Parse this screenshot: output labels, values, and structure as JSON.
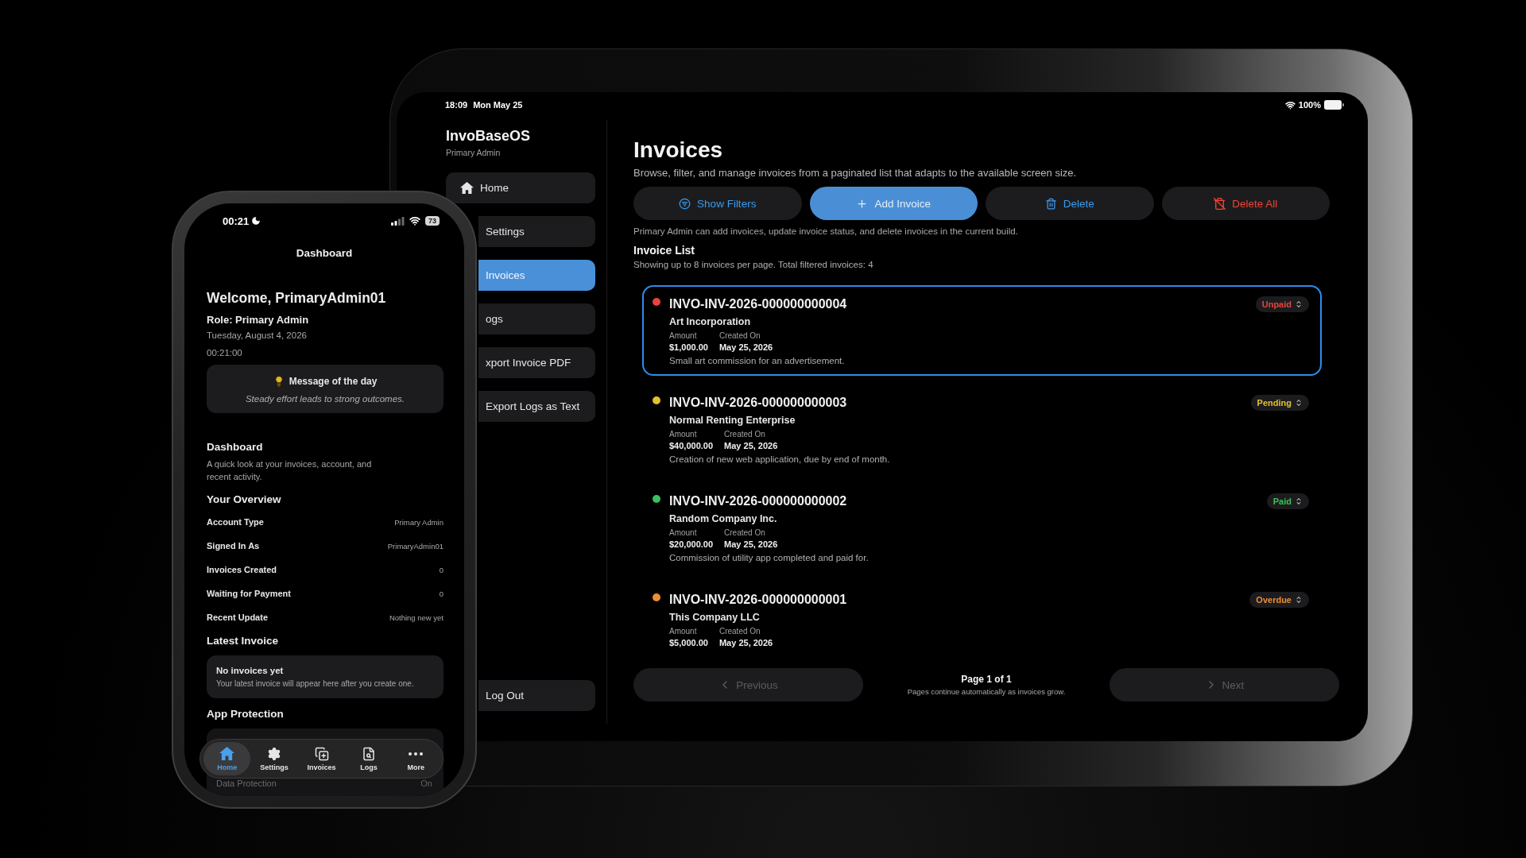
{
  "phone": {
    "status_bar": {
      "time": "00:21",
      "battery": "73"
    },
    "nav_title": "Dashboard",
    "welcome": "Welcome, PrimaryAdmin01",
    "role": "Role: Primary Admin",
    "date": "Tuesday, August 4, 2026",
    "clock": "00:21:00",
    "message_card": {
      "title": "Message of the day",
      "text": "Steady effort leads to strong outcomes."
    },
    "dashboard": {
      "heading": "Dashboard",
      "description": "A quick look at your invoices, account, and recent activity."
    },
    "overview": {
      "heading": "Your Overview",
      "rows": [
        {
          "label": "Account Type",
          "value": "Primary Admin"
        },
        {
          "label": "Signed In As",
          "value": "PrimaryAdmin01"
        },
        {
          "label": "Invoices Created",
          "value": "0"
        },
        {
          "label": "Waiting for Payment",
          "value": "0"
        },
        {
          "label": "Recent Update",
          "value": "Nothing new yet"
        }
      ]
    },
    "latest_invoice": {
      "heading": "Latest Invoice",
      "title": "No invoices yet",
      "text": "Your latest invoice will appear here after you create one."
    },
    "app_protection": {
      "heading": "App Protection",
      "rows": [
        {
          "label": "Data Protection",
          "value": "On"
        }
      ]
    },
    "tab_bar": [
      {
        "label": "Home",
        "selected": true
      },
      {
        "label": "Settings",
        "selected": false
      },
      {
        "label": "Invoices",
        "selected": false
      },
      {
        "label": "Logs",
        "selected": false
      },
      {
        "label": "More",
        "selected": false
      }
    ]
  },
  "tablet": {
    "status_bar": {
      "time": "18:09",
      "date": "Mon May 25",
      "battery": "100%"
    },
    "sidebar": {
      "title": "InvoBaseOS",
      "subtitle": "Primary Admin",
      "items": [
        {
          "label": "Home",
          "kind": "icon",
          "selected": false
        },
        {
          "label": "Settings",
          "kind": "text",
          "selected": false
        },
        {
          "label": "Invoices",
          "kind": "text",
          "selected": true
        },
        {
          "label": "ogs",
          "kind": "text",
          "selected": false
        },
        {
          "label": "xport Invoice PDF",
          "kind": "text",
          "selected": false
        },
        {
          "label": "Export Logs as Text",
          "kind": "text",
          "selected": false
        }
      ],
      "footer_item": "Log Out"
    },
    "page": {
      "title": "Invoices",
      "description": "Browse, filter, and manage invoices from a paginated list that adapts to the available screen size.",
      "buttons": [
        {
          "label": "Show Filters",
          "kind": "secondary"
        },
        {
          "label": "Add Invoice",
          "kind": "primary"
        },
        {
          "label": "Delete",
          "kind": "secondary"
        },
        {
          "label": "Delete All",
          "kind": "destructive"
        }
      ],
      "note": "Primary Admin can add invoices, update invoice status, and delete invoices in the current build.",
      "list": {
        "title": "Invoice List",
        "subtitle": "Showing up to 8 invoices per page. Total filtered invoices: 4",
        "items": [
          {
            "number": "INVO-INV-2026-000000000004",
            "company": "Art Incorporation",
            "amount_label": "Amount",
            "amount": "$1,000.00",
            "created_label": "Created On",
            "created": "May 25, 2026",
            "description": "Small art commission for an advertisement.",
            "status": "Unpaid",
            "color": "#e5453c",
            "selected": true
          },
          {
            "number": "INVO-INV-2026-000000000003",
            "company": "Normal Renting Enterprise",
            "amount_label": "Amount",
            "amount": "$40,000.00",
            "created_label": "Created On",
            "created": "May 25, 2026",
            "description": "Creation of new web application, due by end of month.",
            "status": "Pending",
            "color": "#e3c02c",
            "selected": false
          },
          {
            "number": "INVO-INV-2026-000000000002",
            "company": "Random Company Inc.",
            "amount_label": "Amount",
            "amount": "$20,000.00",
            "created_label": "Created On",
            "created": "May 25, 2026",
            "description": "Commission of utility app completed and paid for.",
            "status": "Paid",
            "color": "#3cc05c",
            "selected": false
          },
          {
            "number": "INVO-INV-2026-000000000001",
            "company": "This Company LLC",
            "amount_label": "Amount",
            "amount": "$5,000.00",
            "created_label": "Created On",
            "created": "May 25, 2026",
            "status": "Overdue",
            "color": "#ec8f34",
            "selected": false
          }
        ]
      },
      "pagination": {
        "previous": {
          "label": "Previous",
          "disabled": true
        },
        "page": "Page 1 of 1",
        "hint": "Pages continue automatically as invoices grow.",
        "next": {
          "label": "Next",
          "disabled": true
        }
      }
    }
  }
}
